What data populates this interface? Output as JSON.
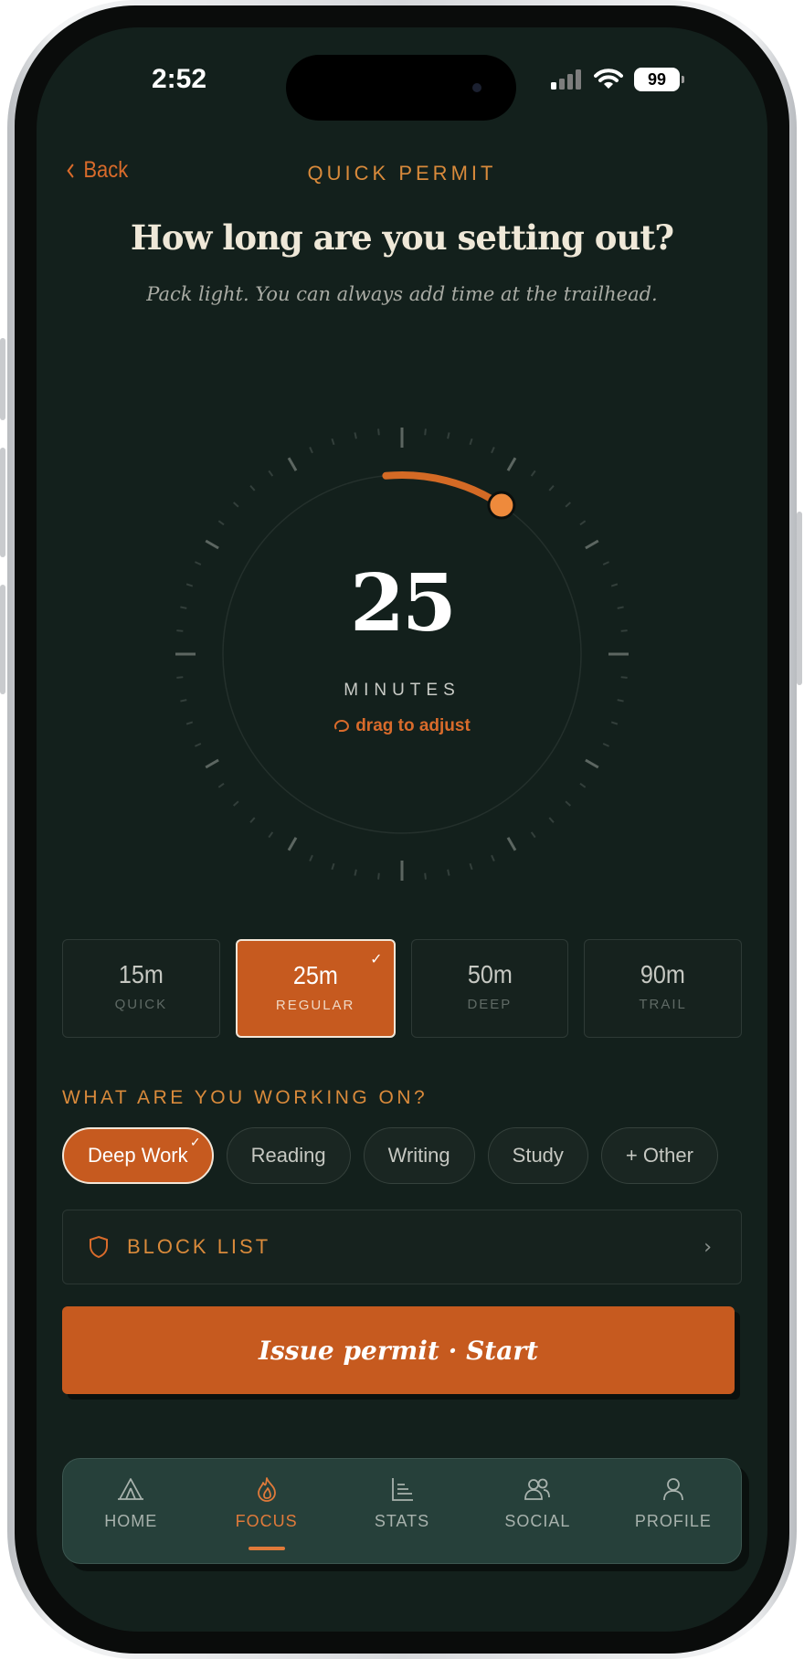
{
  "status_bar": {
    "time": "2:52",
    "battery": "99"
  },
  "nav": {
    "back_label": "Back",
    "title": "QUICK PERMIT"
  },
  "heading": "How long are you setting out?",
  "subheading": "Pack light. You can always add time at the trailhead.",
  "dial": {
    "value": "25",
    "unit": "MINUTES",
    "hint": "drag to adjust",
    "max_minutes": 120
  },
  "presets": [
    {
      "value": "15m",
      "label": "QUICK",
      "selected": false
    },
    {
      "value": "25m",
      "label": "REGULAR",
      "selected": true
    },
    {
      "value": "50m",
      "label": "DEEP",
      "selected": false
    },
    {
      "value": "90m",
      "label": "TRAIL",
      "selected": false
    }
  ],
  "task_section": {
    "title": "WHAT ARE YOU WORKING ON?",
    "chips": [
      {
        "label": "Deep Work",
        "selected": true
      },
      {
        "label": "Reading",
        "selected": false
      },
      {
        "label": "Writing",
        "selected": false
      },
      {
        "label": "Study",
        "selected": false
      },
      {
        "label": "+ Other",
        "selected": false
      }
    ]
  },
  "block_list": {
    "label": "BLOCK LIST"
  },
  "cta": {
    "label": "Issue permit · Start"
  },
  "tabbar": {
    "active": "FOCUS",
    "tabs": [
      {
        "label": "HOME",
        "icon": "tent-icon"
      },
      {
        "label": "FOCUS",
        "icon": "flame-icon"
      },
      {
        "label": "STATS",
        "icon": "chart-icon"
      },
      {
        "label": "SOCIAL",
        "icon": "people-icon"
      },
      {
        "label": "PROFILE",
        "icon": "person-icon"
      }
    ]
  },
  "colors": {
    "background": "#13201c",
    "accent": "#c65a1f",
    "accent_text": "#d98a3b",
    "heading": "#efe8d8"
  }
}
